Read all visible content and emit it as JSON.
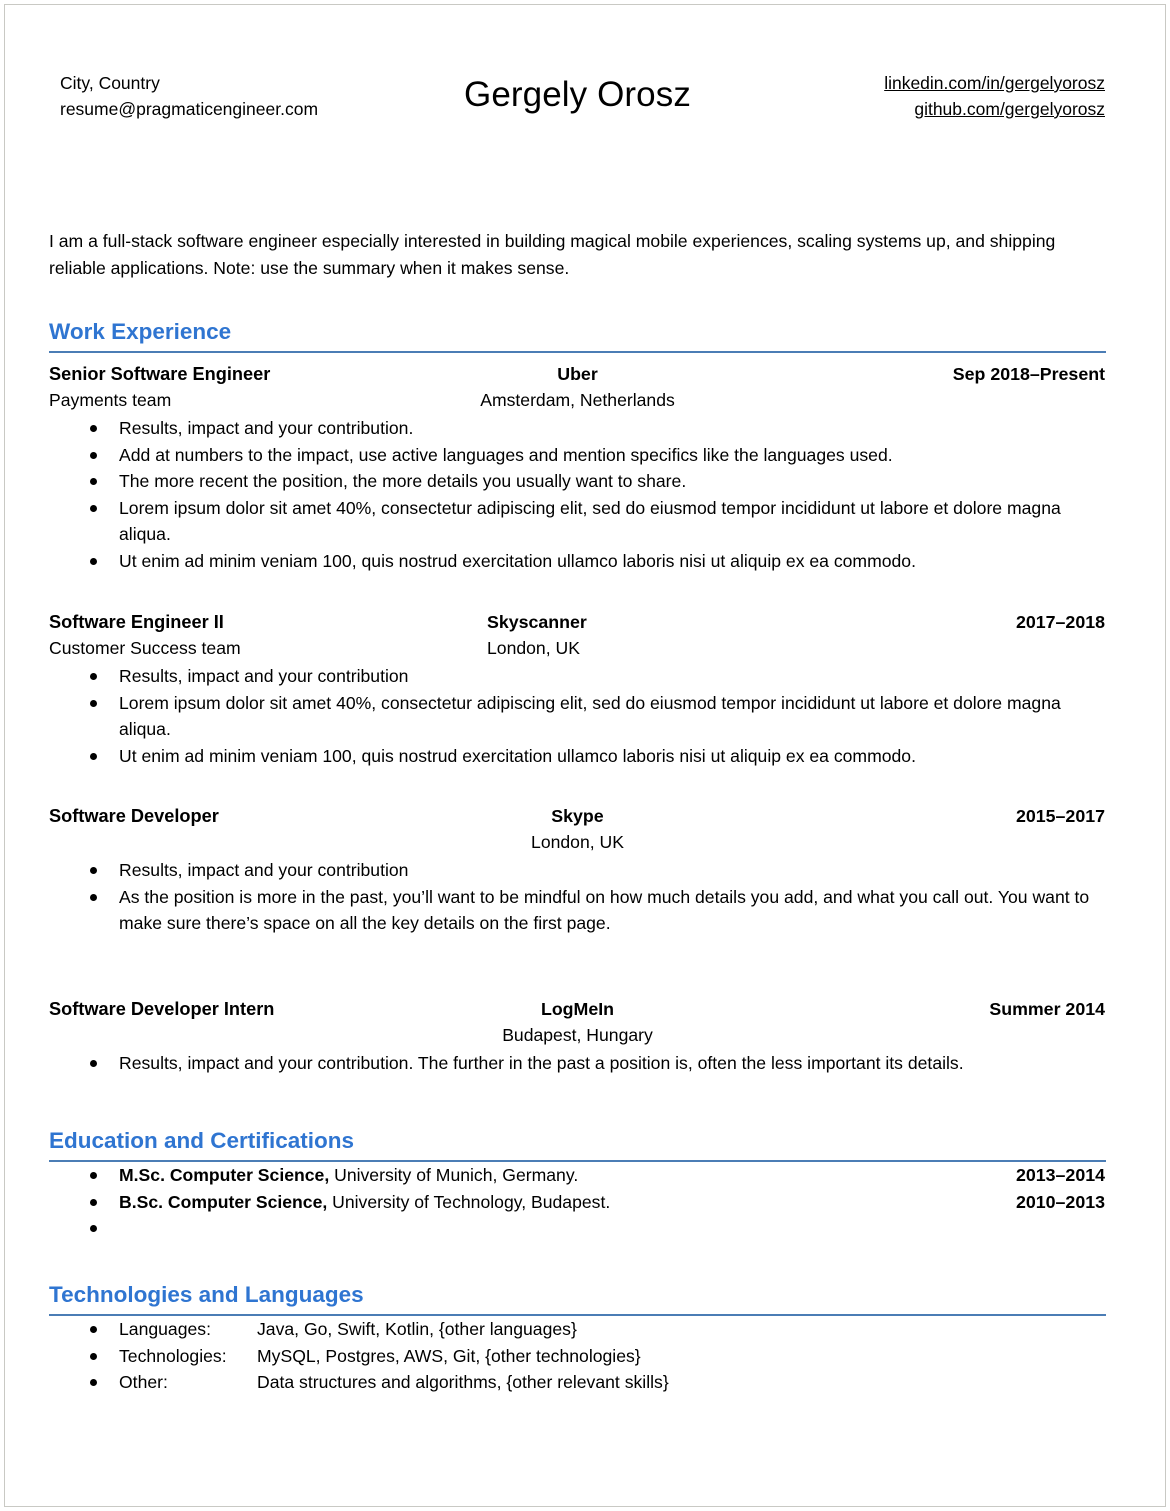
{
  "header": {
    "location": "City, Country",
    "email": "resume@pragmaticengineer.com",
    "name": "Gergely Orosz",
    "linkedin": "linkedin.com/in/gergelyorosz",
    "github": "github.com/gergelyorosz"
  },
  "summary": "I am a full-stack software engineer especially interested in building magical mobile experiences, scaling systems up, and shipping reliable applications. Note: use the summary when it makes sense.",
  "theme": {
    "heading_color": "#2f75d1",
    "rule_color": "#4b7db5",
    "text_color": "#000000",
    "page_background": "#ffffff",
    "page_border": "#c9c9c4"
  },
  "sections": {
    "work": {
      "title": "Work Experience",
      "jobs": [
        {
          "title": "Senior Software Engineer",
          "subtitle": "Payments team",
          "company": "Uber",
          "location": "Amsterdam, Netherlands",
          "dates": "Sep 2018–Present",
          "company_align": "center",
          "bullets": [
            "Results, impact and your contribution.",
            "Add at numbers to the impact, use active languages and mention specifics like the languages used.",
            "The more recent the position, the more details you usually want to share.",
            "Lorem ipsum dolor sit amet 40%, consectetur adipiscing elit, sed do eiusmod tempor incididunt ut labore et dolore magna aliqua.",
            "Ut enim ad minim veniam 100, quis nostrud exercitation ullamco laboris nisi ut aliquip ex ea commodo."
          ]
        },
        {
          "title": "Software Engineer II",
          "subtitle": "Customer Success team",
          "company": "Skyscanner",
          "location": "London, UK",
          "dates": "2017–2018",
          "company_align": "left",
          "bullets": [
            "Results, impact and your contribution",
            "Lorem ipsum dolor sit amet 40%, consectetur adipiscing elit, sed do eiusmod tempor incididunt ut labore et dolore magna aliqua.",
            "Ut enim ad minim veniam 100, quis nostrud exercitation ullamco laboris nisi ut aliquip ex ea commodo."
          ]
        },
        {
          "title": "Software Developer",
          "subtitle": "",
          "company": "Skype",
          "location": "London, UK",
          "dates": "2015–2017",
          "company_align": "center",
          "bullets": [
            "Results, impact and your contribution",
            "As the position is more in the past, you’ll want to be mindful on how much details you add, and what you call out. You want to make sure there’s space on all the key details on the first page."
          ]
        },
        {
          "title": "Software Developer Intern",
          "subtitle": "",
          "company": "LogMeIn",
          "location": "Budapest, Hungary",
          "dates": "Summer 2014",
          "company_align": "center",
          "bullets": [
            "Results, impact and your contribution. The further in the past a position is, often the less important its details."
          ]
        }
      ]
    },
    "education": {
      "title": "Education and Certifications",
      "items": [
        {
          "degree": "M.Sc. Computer Science,",
          "institution": " University of Munich, Germany.",
          "dates": "2013–2014"
        },
        {
          "degree": "B.Sc. Computer Science,",
          "institution": " University of Technology, Budapest.",
          "dates": "2010–2013"
        },
        {
          "degree": "",
          "institution": "",
          "dates": ""
        }
      ]
    },
    "technologies": {
      "title": "Technologies and Languages",
      "rows": [
        {
          "label": "Languages:",
          "value": "Java, Go, Swift, Kotlin, {other languages}"
        },
        {
          "label": "Technologies:",
          "value": "MySQL, Postgres, AWS, Git, {other technologies}"
        },
        {
          "label": "Other:",
          "value": "Data structures and algorithms, {other relevant skills}"
        }
      ]
    }
  }
}
